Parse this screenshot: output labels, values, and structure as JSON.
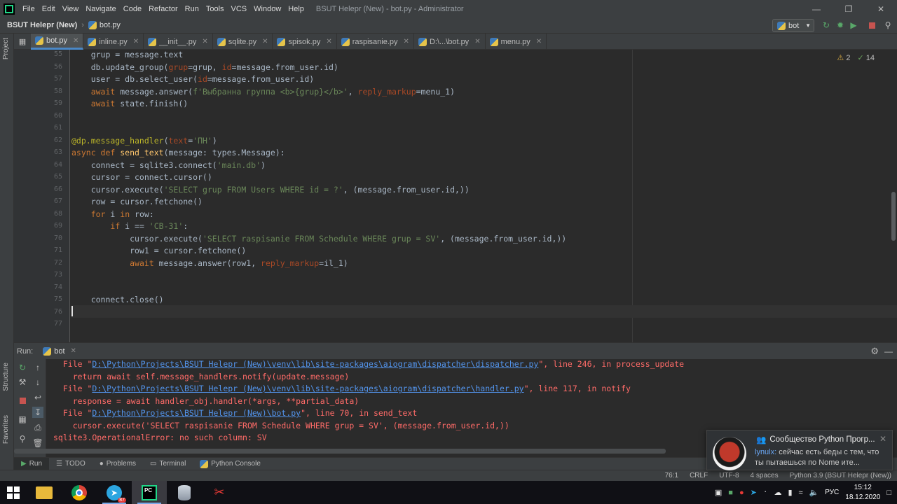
{
  "menu": {
    "items": [
      "File",
      "Edit",
      "View",
      "Navigate",
      "Code",
      "Refactor",
      "Run",
      "Tools",
      "VCS",
      "Window",
      "Help"
    ],
    "window_title": "BSUT Helepr (New) - bot.py - Administrator"
  },
  "nav": {
    "project": "BSUT Helepr (New)",
    "file": "bot.py",
    "run_config": "bot"
  },
  "left_stripe": {
    "project": "Project",
    "structure": "Structure",
    "favorites": "Favorites"
  },
  "tabs": [
    {
      "label": "bot.py",
      "active": true
    },
    {
      "label": "inline.py"
    },
    {
      "label": "__init__.py"
    },
    {
      "label": "sqlite.py"
    },
    {
      "label": "spisok.py"
    },
    {
      "label": "raspisanie.py"
    },
    {
      "label": "D:\\...\\bot.py"
    },
    {
      "label": "menu.py"
    }
  ],
  "inspection": {
    "warnings": "2",
    "weak_warnings": "14"
  },
  "editor": {
    "line_numbers": [
      "55",
      "56",
      "57",
      "58",
      "59",
      "60",
      "61",
      "62",
      "63",
      "64",
      "65",
      "66",
      "67",
      "68",
      "69",
      "70",
      "71",
      "72",
      "73",
      "74",
      "75",
      "76",
      "77"
    ],
    "lines": [
      "    grup = message.text",
      "    db.update_group(grup=grup, id=message.from_user.id)",
      "    user = db.select_user(id=message.from_user.id)",
      "    await message.answer(f'Выбранна группа <b>{grup}</b>', reply_markup=menu_1)",
      "    await state.finish()",
      "",
      "",
      "@dp.message_handler(text='ПН')",
      "async def send_text(message: types.Message):",
      "    connect = sqlite3.connect('main.db')",
      "    cursor = connect.cursor()",
      "    cursor.execute('SELECT grup FROM Users WHERE id = ?', (message.from_user.id,))",
      "    row = cursor.fetchone()",
      "    for i in row:",
      "        if i == 'СВ-31':",
      "            cursor.execute('SELECT raspisanie FROM Schedule WHERE grup = SV', (message.from_user.id,))",
      "            row1 = cursor.fetchone()",
      "            await message.answer(row1, reply_markup=il_1)",
      "",
      "",
      "    connect.close()",
      "",
      ""
    ]
  },
  "run": {
    "label": "Run:",
    "tab": "bot",
    "console": [
      {
        "pre": "  File \"",
        "link": "D:\\Python\\Projects\\BSUT Helepr (New)\\venv\\lib\\site-packages\\aiogram\\dispatcher\\dispatcher.py",
        "post": "\", line 246, in process_update"
      },
      {
        "pre": "    return await self.message_handlers.notify(update.message)"
      },
      {
        "pre": "  File \"",
        "link": "D:\\Python\\Projects\\BSUT Helepr (New)\\venv\\lib\\site-packages\\aiogram\\dispatcher\\handler.py",
        "post": "\", line 117, in notify"
      },
      {
        "pre": "    response = await handler_obj.handler(*args, **partial_data)"
      },
      {
        "pre": "  File \"",
        "link": "D:\\Python\\Projects\\BSUT Helepr (New)\\bot.py",
        "post": "\", line 70, in send_text"
      },
      {
        "pre": "    cursor.execute('SELECT raspisanie FROM Schedule WHERE grup = SV', (message.from_user.id,))"
      },
      {
        "pre": "sqlite3.OperationalError: no such column: SV"
      }
    ]
  },
  "tool_windows": [
    {
      "label": "Run",
      "icon": "run-icon",
      "active": true
    },
    {
      "label": "TODO",
      "icon": "todo-icon"
    },
    {
      "label": "Problems",
      "icon": "problems-icon"
    },
    {
      "label": "Terminal",
      "icon": "terminal-icon"
    },
    {
      "label": "Python Console",
      "icon": "python-console-icon"
    }
  ],
  "status": {
    "position": "76:1",
    "line_sep": "CRLF",
    "encoding": "UTF-8",
    "indent": "4 spaces",
    "interpreter": "Python 3.9 (BSUT Helepr (New))"
  },
  "notification": {
    "title": "Сообщество Python Прогр...",
    "user": "lynulx:",
    "text": "сейчас есть беды с тем, что ты пытаешься по No",
    "suffix": "me ите..."
  },
  "taskbar": {
    "lang": "РУС",
    "time": "15:12",
    "date": "18.12.2020",
    "telegram_badge": "87"
  },
  "colors": {
    "accent": "#4a88c7",
    "error": "#ff6b68",
    "link": "#5394ec"
  }
}
